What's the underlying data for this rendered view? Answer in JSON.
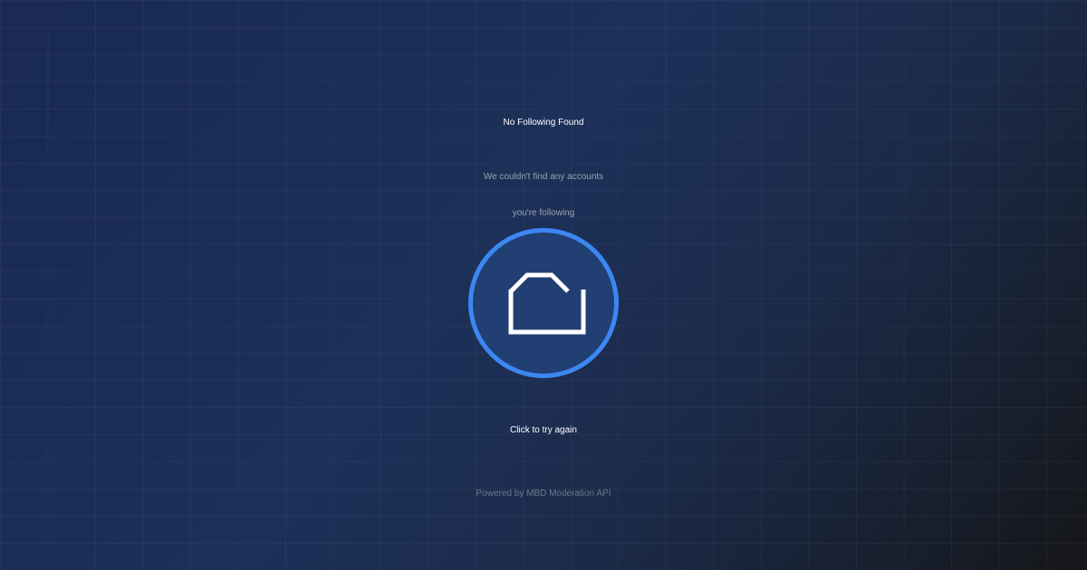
{
  "empty_state": {
    "title": "No Following Found",
    "message_line1": "We couldn't find any accounts",
    "message_line2": "you're following",
    "icon": "folder-outline-icon",
    "retry_label": "Click to try again",
    "footer": "Powered by MBD Moderation API"
  },
  "colors": {
    "background": "#1c2f57",
    "accent": "#3c87f2",
    "badge_fill": "#213f72",
    "text_primary": "#ffffff",
    "text_secondary": "#9aa3b1",
    "text_muted": "#6e7888"
  }
}
